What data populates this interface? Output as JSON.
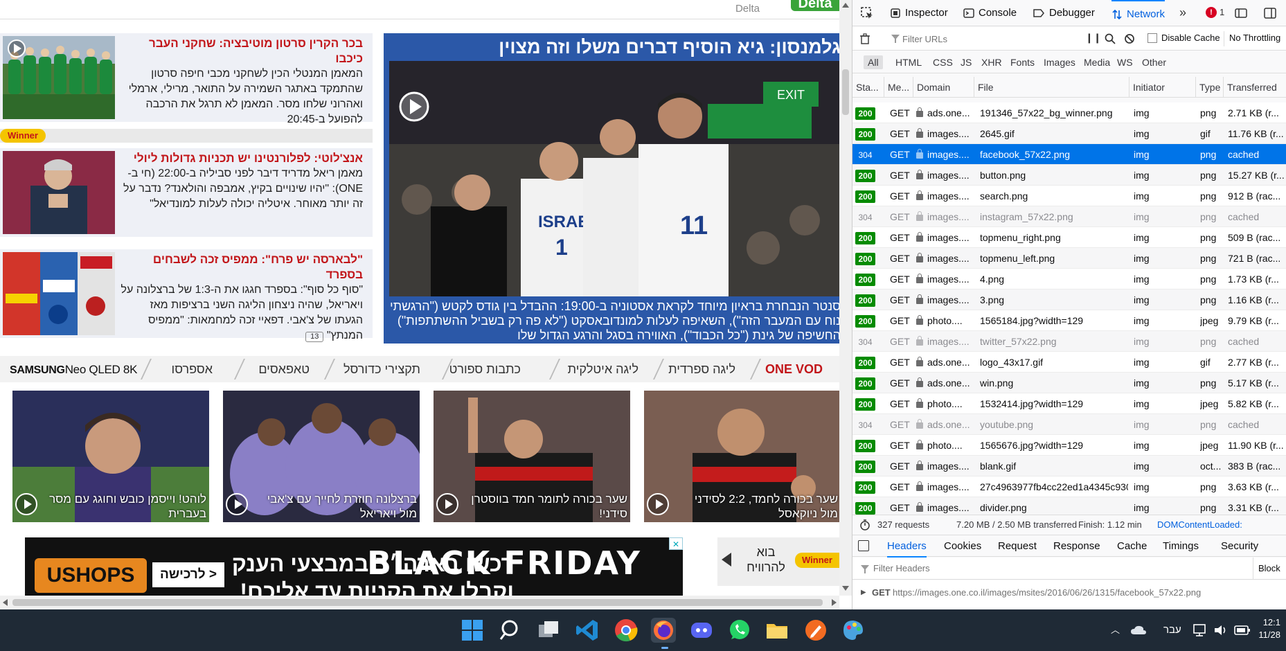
{
  "site": {
    "top": {
      "delta": "Delta",
      "delta_logo": "Delta"
    },
    "left_news": [
      {
        "title": "בכר הקרין סרטון מוטיבציה: שחקני העבר כיכבו",
        "body": "המאמן המנטלי הכין לשחקני מכבי חיפה סרטון שהתמקד באתגר השמירה על התואר, מרילי, ארמלי ואהרוני שלחו מסר. המאמן לא תרגל את הרכבה להפועל ב-20:45"
      },
      {
        "title": "אנצ'לוטי: לפלורנטינו יש תכניות גדולות ליולי",
        "body": "מאמן ריאל מדריד דיבר לפני סביליה ב-22:00 (חי ב-ONE): \"יהיו שינויים בקיץ, אמבפה והולאנד? נדבר על זה יותר מאוחר. איטליה יכולה לעלות למונדיאל\""
      },
      {
        "title": "\"לבארסה יש פרח\": ממפיס זכה לשבחים בספרד",
        "body": "\"סוף כל סוף\": בספרד חגגו את ה-1:3 של ברצלונה על ויאריאל, שהיה ניצחון הליגה השני ברציפות מאז הגעתו של צ'אבי. דפאיי זכה למחמאות: \"ממפיס המנתץ\"",
        "comments": "13"
      }
    ],
    "winner_label": "Winner",
    "hero": {
      "title": "גלמנסון: גיא הוסיף דברים משלו וזה מצוין",
      "caption": "סנטר הנבחרת בראיון מיוחד לקראת אסטוניה ב-19:00: ההבדל בין גודס לקטש (\"הרגשתי נוח עם המעבר הזה\"), השאיפה לעלות למונדובאסקט (\"לא פה רק בשביל ההשתתפות\") החשיפה של גינת (\"כל הכבוד\"), האווירה בסגל והרגע הגדול שלו"
    },
    "catnav": {
      "items": [
        "ONE VOD",
        "ליגה ספרדית",
        "ליגה איטלקית",
        "כתבות ספורט",
        "תקצירי כדורסל",
        "טאפאסים",
        "אספרסו"
      ],
      "sponsor_brand": "SAMSUNG",
      "sponsor_product": "Neo QLED 8K"
    },
    "videos": [
      {
        "caption": "לוהט! וייסמן כובש וחוגג עם מסר בעברית"
      },
      {
        "caption": "ברצלונה חוזרת לחייך עם צ'אבי מול ויאריאל"
      },
      {
        "caption": "שער בכורה לתומר חמד בווסטרן סידני!"
      },
      {
        "caption": "שער בכורה לחמד, 2:2 לסידני מול ניוקאסל"
      }
    ],
    "ad": {
      "brand": "USHOPS",
      "cta": "לרכישה >",
      "text": "רכשו בארה״ב במבצעי הענק וקבלו את הקניות עד אליכם!",
      "bf": "BLACK FRIDAY"
    },
    "ad_right": {
      "text": "בוא להרוויח",
      "logo": "Winner"
    }
  },
  "devtools": {
    "tabs": [
      "Inspector",
      "Console",
      "Debugger",
      "Network"
    ],
    "active_tab": "Network",
    "error_count": "1",
    "filter_placeholder": "Filter URLs",
    "disable_cache": "Disable Cache",
    "throttling": "No Throttling",
    "types": [
      "All",
      "HTML",
      "CSS",
      "JS",
      "XHR",
      "Fonts",
      "Images",
      "Media",
      "WS",
      "Other"
    ],
    "columns": [
      "Sta...",
      "Me...",
      "Domain",
      "File",
      "Initiator",
      "Type",
      "Transferred"
    ],
    "requests": [
      {
        "status": "200",
        "method": "GET",
        "domain": "ads.one...",
        "file": "191346_57x22_bg_winner.png",
        "initiator": "img",
        "type": "png",
        "transferred": "2.71 KB (r..."
      },
      {
        "status": "200",
        "method": "GET",
        "domain": "images....",
        "file": "2645.gif",
        "initiator": "img",
        "type": "gif",
        "transferred": "11.76 KB (r..."
      },
      {
        "status": "304",
        "method": "GET",
        "domain": "images....",
        "file": "facebook_57x22.png",
        "initiator": "img",
        "type": "png",
        "transferred": "cached"
      },
      {
        "status": "200",
        "method": "GET",
        "domain": "images....",
        "file": "button.png",
        "initiator": "img",
        "type": "png",
        "transferred": "15.27 KB (r..."
      },
      {
        "status": "200",
        "method": "GET",
        "domain": "images....",
        "file": "search.png",
        "initiator": "img",
        "type": "png",
        "transferred": "912 B (rac..."
      },
      {
        "status": "304",
        "method": "GET",
        "domain": "images....",
        "file": "instagram_57x22.png",
        "initiator": "img",
        "type": "png",
        "transferred": "cached"
      },
      {
        "status": "200",
        "method": "GET",
        "domain": "images....",
        "file": "topmenu_right.png",
        "initiator": "img",
        "type": "png",
        "transferred": "509 B (rac..."
      },
      {
        "status": "200",
        "method": "GET",
        "domain": "images....",
        "file": "topmenu_left.png",
        "initiator": "img",
        "type": "png",
        "transferred": "721 B (rac..."
      },
      {
        "status": "200",
        "method": "GET",
        "domain": "images....",
        "file": "4.png",
        "initiator": "img",
        "type": "png",
        "transferred": "1.73 KB (r..."
      },
      {
        "status": "200",
        "method": "GET",
        "domain": "images....",
        "file": "3.png",
        "initiator": "img",
        "type": "png",
        "transferred": "1.16 KB (r..."
      },
      {
        "status": "200",
        "method": "GET",
        "domain": "photo....",
        "file": "1565184.jpg?width=129",
        "initiator": "img",
        "type": "jpeg",
        "transferred": "9.79 KB (r..."
      },
      {
        "status": "304",
        "method": "GET",
        "domain": "images....",
        "file": "twitter_57x22.png",
        "initiator": "img",
        "type": "png",
        "transferred": "cached"
      },
      {
        "status": "200",
        "method": "GET",
        "domain": "ads.one...",
        "file": "logo_43x17.gif",
        "initiator": "img",
        "type": "gif",
        "transferred": "2.77 KB (r..."
      },
      {
        "status": "200",
        "method": "GET",
        "domain": "ads.one...",
        "file": "win.png",
        "initiator": "img",
        "type": "png",
        "transferred": "5.17 KB (r..."
      },
      {
        "status": "200",
        "method": "GET",
        "domain": "photo....",
        "file": "1532414.jpg?width=129",
        "initiator": "img",
        "type": "jpeg",
        "transferred": "5.82 KB (r..."
      },
      {
        "status": "304",
        "method": "GET",
        "domain": "ads.one...",
        "file": "youtube.png",
        "initiator": "img",
        "type": "png",
        "transferred": "cached"
      },
      {
        "status": "200",
        "method": "GET",
        "domain": "photo....",
        "file": "1565676.jpg?width=129",
        "initiator": "img",
        "type": "jpeg",
        "transferred": "11.90 KB (r..."
      },
      {
        "status": "200",
        "method": "GET",
        "domain": "images....",
        "file": "blank.gif",
        "initiator": "img",
        "type": "oct...",
        "transferred": "383 B (rac..."
      },
      {
        "status": "200",
        "method": "GET",
        "domain": "images....",
        "file": "27c4963977fb4cc22ed1a4345c930",
        "initiator": "img",
        "type": "png",
        "transferred": "3.63 KB (r..."
      },
      {
        "status": "200",
        "method": "GET",
        "domain": "images....",
        "file": "divider.png",
        "initiator": "img",
        "type": "png",
        "transferred": "3.31 KB (r..."
      }
    ],
    "status": {
      "requests": "327 requests",
      "size": "7.20 MB / 2.50 MB transferred",
      "finish": "Finish: 1.12 min",
      "dcl": "DOMContentLoaded:"
    },
    "detail_tabs": [
      "Headers",
      "Cookies",
      "Request",
      "Response",
      "Cache",
      "Timings",
      "Security"
    ],
    "filter_headers": "Filter Headers",
    "block": "Block",
    "url_method": "GET",
    "url": "https://images.one.co.il/images/msites/2016/06/26/1315/facebook_57x22.png"
  },
  "taskbar": {
    "lang": "עבר",
    "time": "12:1",
    "date": "11/28"
  }
}
